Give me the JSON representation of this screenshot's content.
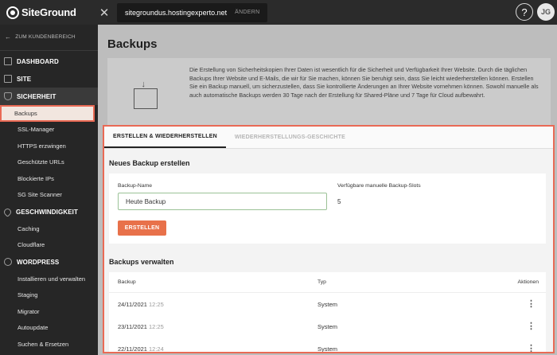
{
  "topbar": {
    "logo_text": "SiteGround",
    "site_url": "sitegroundus.hostingexperto.net",
    "change_label": "ÄNDERN",
    "help_icon": "?",
    "avatar_initials": "JG"
  },
  "sidebar": {
    "back_label": "ZUM KUNDENBEREICH",
    "sections": {
      "dashboard": "DASHBOARD",
      "site": "SITE",
      "security": "SICHERHEIT",
      "speed": "GESCHWINDIGKEIT",
      "wordpress": "WORDPRESS"
    },
    "security_items": [
      "Backups",
      "SSL-Manager",
      "HTTPS erzwingen",
      "Geschützte URLs",
      "Blockierte IPs",
      "SG Site Scanner"
    ],
    "speed_items": [
      "Caching",
      "Cloudflare"
    ],
    "wordpress_items": [
      "Installieren und verwalten",
      "Staging",
      "Migrator",
      "Autoupdate",
      "Suchen & Ersetzen"
    ]
  },
  "main": {
    "title": "Backups",
    "intro_text": "Die Erstellung von Sicherheitskopien Ihrer Daten ist wesentlich für die Sicherheit und Verfügbarkeit Ihrer Website. Durch die täglichen Backups Ihrer Website und E-Mails, die wir für Sie machen, können Sie beruhigt sein, dass Sie leicht wiederherstellen können. Erstellen Sie ein Backup manuell, um sicherzustellen, dass Sie kontrollierte Änderungen an Ihrer Website vornehmen können. Sowohl manuelle als auch automatische Backups werden 30 Tage nach der Erstellung für Shared-Pläne und 7 Tage für Cloud aufbewahrt.",
    "tabs": [
      "ERSTELLEN & WIEDERHERSTELLEN",
      "WIEDERHERSTELLUNGS-GESCHICHTE"
    ],
    "create": {
      "title": "Neues Backup erstellen",
      "name_label": "Backup-Name",
      "name_value": "Heute Backup",
      "slots_label": "Verfügbare manuelle Backup-Slots",
      "slots_value": "5",
      "button_label": "ERSTELLEN"
    },
    "manage": {
      "title": "Backups verwalten",
      "columns": [
        "Backup",
        "Typ",
        "Aktionen"
      ],
      "rows": [
        {
          "date": "24/11/2021",
          "time": "12:25",
          "type": "System"
        },
        {
          "date": "23/11/2021",
          "time": "12:25",
          "type": "System"
        },
        {
          "date": "22/11/2021",
          "time": "12:24",
          "type": "System"
        }
      ]
    }
  },
  "colors": {
    "accent": "#e8714a",
    "highlight_border": "#e96a55",
    "sidebar_bg": "#262626",
    "topbar_bg": "#2b2b2b"
  }
}
